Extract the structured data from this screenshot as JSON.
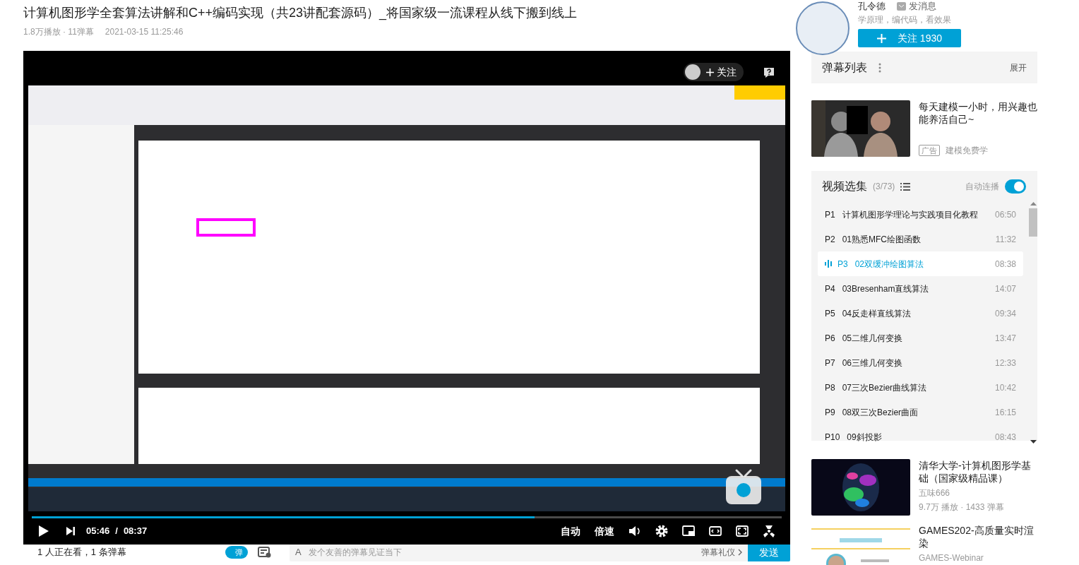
{
  "video": {
    "title": "计算机图形学全套算法讲解和C++编码实现（共23讲配套源码）_将国家级一流课程从线下搬到线上",
    "views": "1.8万播放 · 11弹幕",
    "date": "2021-03-15 11:25:46"
  },
  "player": {
    "follow_label": "关注",
    "progress": {
      "level": 0.67
    },
    "time_current": "05:46",
    "time_separator": "/",
    "time_total": "08:37",
    "text_buttons": [
      "自动",
      "倍速"
    ]
  },
  "bottom_bar": {
    "viewers": "1 人正在看，1 条弹幕",
    "danmaku_toggle": {
      "label": "弹",
      "on": true
    },
    "input": {
      "icon_text": "A",
      "placeholder": "发个友善的弹幕见证当下"
    },
    "etiquette": "弹幕礼仪",
    "send": "发送"
  },
  "uploader": {
    "name": "孔令德",
    "message": "发消息",
    "bio": "学原理，编代码，看效果",
    "follow": "关注 1930"
  },
  "danmaku_list": {
    "title": "弹幕列表",
    "expand": "展开"
  },
  "ad": {
    "title": "每天建模一小时，用兴趣也能养活自己~",
    "tag": "广告",
    "source": "建模免费学"
  },
  "episodes": {
    "title": "视频选集",
    "count": "(3/73)",
    "autoplay_label": "自动连播",
    "autoplay": true,
    "items": [
      {
        "part": "P1",
        "title": "计算机图形学理论与实践项目化教程",
        "duration": "06:50",
        "selected": false
      },
      {
        "part": "P2",
        "title": "01熟悉MFC绘图函数",
        "duration": "11:32",
        "selected": false
      },
      {
        "part": "P3",
        "title": "02双缓冲绘图算法",
        "duration": "08:38",
        "selected": true
      },
      {
        "part": "P4",
        "title": "03Bresenham直线算法",
        "duration": "14:07",
        "selected": false
      },
      {
        "part": "P5",
        "title": "04反走样直线算法",
        "duration": "09:34",
        "selected": false
      },
      {
        "part": "P6",
        "title": "05二维几何变换",
        "duration": "13:47",
        "selected": false
      },
      {
        "part": "P7",
        "title": "06三维几何变换",
        "duration": "12:33",
        "selected": false
      },
      {
        "part": "P8",
        "title": "07三次Bezier曲线算法",
        "duration": "10:42",
        "selected": false
      },
      {
        "part": "P9",
        "title": "08双三次Bezier曲面",
        "duration": "16:15",
        "selected": false
      },
      {
        "part": "P10",
        "title": "09斜投影",
        "duration": "08:43",
        "selected": false
      }
    ]
  },
  "recommendations": [
    {
      "kind": "picture",
      "title": "清华大学-计算机图形学基础（国家级精品课）",
      "author": "五味666",
      "stats": "9.7万 播放 · 1433 弹幕"
    },
    {
      "kind": "picture",
      "title": "GAMES202-高质量实时渲染",
      "author": "GAMES-Webinar"
    }
  ]
}
